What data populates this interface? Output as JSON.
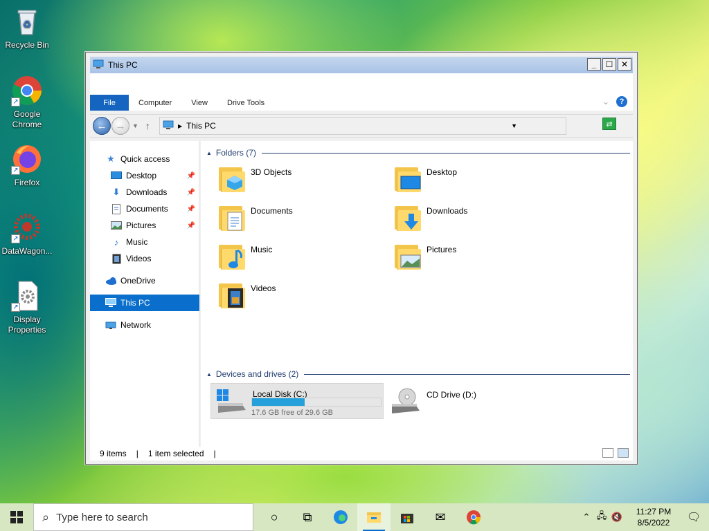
{
  "desktop": {
    "icons": [
      {
        "label": "Recycle Bin"
      },
      {
        "label": "Google Chrome"
      },
      {
        "label": "Firefox"
      },
      {
        "label": "DataWagon..."
      },
      {
        "label": "Display Properties"
      }
    ]
  },
  "window": {
    "title": "This PC",
    "controls": {
      "minimize": "_",
      "maximize": "☐",
      "close": "✕"
    },
    "ribbon_tabs": [
      "File",
      "Computer",
      "View",
      "Drive Tools"
    ],
    "address": {
      "path": "This PC"
    },
    "sidebar": {
      "items": [
        {
          "label": "Quick access",
          "icon": "star-icon"
        },
        {
          "label": "Desktop",
          "icon": "desktop-icon",
          "pinned": true
        },
        {
          "label": "Downloads",
          "icon": "download-icon",
          "pinned": true
        },
        {
          "label": "Documents",
          "icon": "document-icon",
          "pinned": true
        },
        {
          "label": "Pictures",
          "icon": "pictures-icon",
          "pinned": true
        },
        {
          "label": "Music",
          "icon": "music-icon"
        },
        {
          "label": "Videos",
          "icon": "videos-icon"
        },
        {
          "label": "OneDrive",
          "icon": "cloud-icon"
        },
        {
          "label": "This PC",
          "icon": "computer-icon",
          "selected": true
        },
        {
          "label": "Network",
          "icon": "network-icon"
        }
      ]
    },
    "folders_header": "Folders (7)",
    "folders": [
      {
        "label": "3D Objects"
      },
      {
        "label": "Desktop"
      },
      {
        "label": "Documents"
      },
      {
        "label": "Downloads"
      },
      {
        "label": "Music"
      },
      {
        "label": "Pictures"
      },
      {
        "label": "Videos"
      }
    ],
    "devices_header": "Devices and drives (2)",
    "drives": [
      {
        "label": "Local Disk (C:)",
        "free_text": "17.6 GB free of 29.6 GB",
        "used_fraction": 0.41
      },
      {
        "label": "CD Drive (D:)"
      }
    ],
    "status": {
      "items": "9 items",
      "selected": "1 item selected",
      "separator": "|"
    }
  },
  "taskbar": {
    "search_placeholder": "Type here to search",
    "time": "11:27 PM",
    "date": "8/5/2022"
  },
  "colors": {
    "accent": "#0a6fcc",
    "file_tab": "#1565c0",
    "folder": "#ffd96b"
  }
}
